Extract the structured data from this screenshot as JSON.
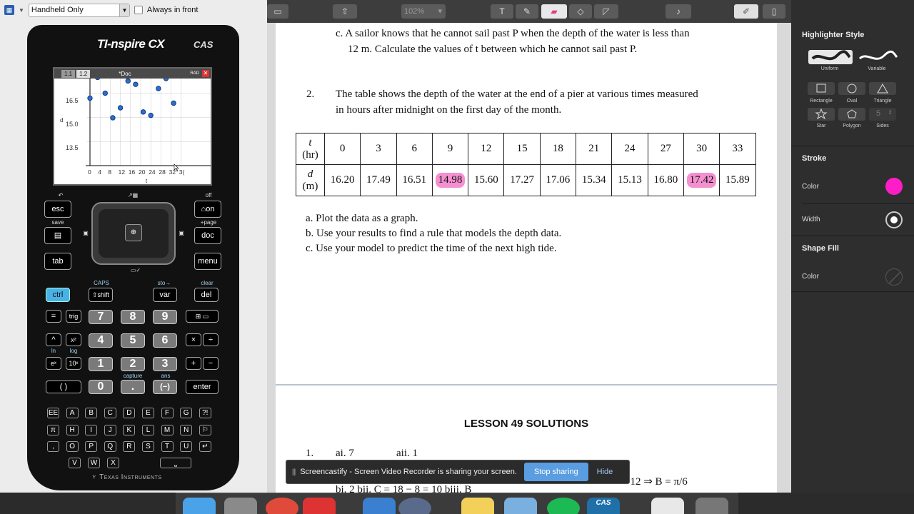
{
  "ti_toolbar": {
    "view_label": "Handheld Only",
    "always_front_label": "Always in front"
  },
  "calculator": {
    "brand": "TI-nspire CX",
    "cas": "CAS",
    "footer": "Texas Instruments",
    "screen": {
      "tabs": [
        "1.1",
        "1.2"
      ],
      "doc_title": "*Doc",
      "mode": "RAD",
      "y_ticks": [
        "16.5",
        "15.0",
        "13.5"
      ],
      "x_ticks": [
        "0",
        "4",
        "8",
        "12",
        "16",
        "20",
        "24",
        "28",
        "32",
        "3("
      ],
      "x_label": "t",
      "y_label": "d"
    },
    "keys": {
      "esc": "esc",
      "on": "on",
      "doc": "doc",
      "tab": "tab",
      "menu": "menu",
      "ctrl": "ctrl",
      "shift": "shift",
      "var": "var",
      "del": "del",
      "eq": "=",
      "trig": "trig",
      "caret": "^",
      "x2": "x²",
      "ex": "eˣ",
      "tenx": "10ˣ",
      "paren": "( )",
      "neg": "(−)",
      "dot": ".",
      "enter": "enter",
      "digits": [
        "7",
        "8",
        "9",
        "4",
        "5",
        "6",
        "1",
        "2",
        "3",
        "0"
      ],
      "ops": [
        "×",
        "÷",
        "+",
        "−"
      ],
      "letters_row1": [
        "EE",
        "A",
        "B",
        "C",
        "D",
        "E",
        "F",
        "G",
        "?!"
      ],
      "letters_row2": [
        "π",
        "H",
        "I",
        "J",
        "K",
        "L",
        "M",
        "N",
        "⚐"
      ],
      "letters_row3": [
        ",",
        "O",
        "P",
        "Q",
        "R",
        "S",
        "T",
        "U",
        "↵"
      ],
      "letters_row4": [
        "V",
        "W",
        "X",
        "⎵"
      ]
    },
    "sublabels": {
      "save": "save",
      "page": "+page",
      "off": "off",
      "caps": "CAPS",
      "sto": "sto→",
      "clear": "clear",
      "ln": "ln",
      "log": "log",
      "capture": "capture",
      "ans": "ans"
    }
  },
  "doc_toolbar": {
    "zoom": "102%",
    "text_tool": "T"
  },
  "document": {
    "part_c_line1": "c.  A sailor knows that he cannot sail past P when the depth of the water is less than",
    "part_c_line2": "12 m. Calculate the values of t between which he cannot sail past P.",
    "q2_number": "2.",
    "q2_line1": "The table shows the depth of the water at the end of a pier at various times measured",
    "q2_line2": "in hours after midnight on the first day of the month.",
    "table": {
      "row1_header": [
        "t",
        "(hr)"
      ],
      "row2_header": [
        "d",
        "(m)"
      ],
      "t_values": [
        "0",
        "3",
        "6",
        "9",
        "12",
        "15",
        "18",
        "21",
        "24",
        "27",
        "30",
        "33"
      ],
      "d_values": [
        "16.20",
        "17.49",
        "16.51",
        "14.98",
        "15.60",
        "17.27",
        "17.06",
        "15.34",
        "15.13",
        "16.80",
        "17.42",
        "15.89"
      ],
      "highlighted_columns": [
        3,
        10
      ]
    },
    "item_a": "a.  Plot the data as a graph.",
    "item_b": "b.  Use your results to find a rule that models the depth data.",
    "item_c": "c.  Use your model to predict the time of the next high tide.",
    "lesson_title": "LESSON 49 SOLUTIONS",
    "sol_line1_num": "1.",
    "sol_ai": "ai.  7",
    "sol_aii": "aii.  1",
    "sol_b_eq": "=12  ⇒  B = π/6",
    "sol_bits": "bi.        2       bii.  C = 18 − 8 = 10   biii.     B"
  },
  "share_bar": {
    "message": "Screencastify - Screen Video Recorder is sharing your screen.",
    "stop": "Stop sharing",
    "hide": "Hide"
  },
  "sidebar": {
    "highlighter_title": "Highlighter Style",
    "uniform": "Uniform",
    "variable": "Variable",
    "rectangle": "Rectangle",
    "oval": "Oval",
    "triangle": "Triangle",
    "star": "Star",
    "polygon": "Polygon",
    "sides": "Sides",
    "sides_value": "5",
    "stroke_title": "Stroke",
    "color_label": "Color",
    "width_label": "Width",
    "stroke_color": "#ff1dc8",
    "fill_title": "Shape Fill",
    "fill_color_label": "Color"
  },
  "dock": {
    "cas_label": "CAS"
  }
}
